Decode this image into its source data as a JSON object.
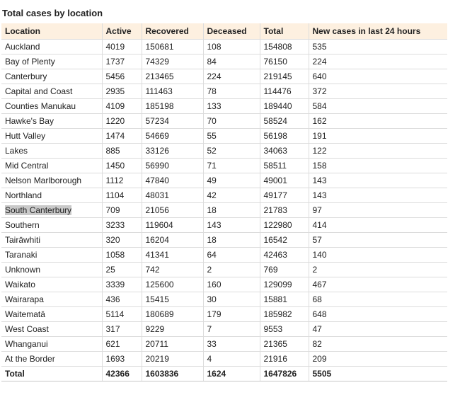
{
  "title": "Total cases by location",
  "columns": [
    "Location",
    "Active",
    "Recovered",
    "Deceased",
    "Total",
    "New cases in last 24 hours"
  ],
  "rows": [
    [
      "Auckland",
      "4019",
      "150681",
      "108",
      "154808",
      "535"
    ],
    [
      "Bay of Plenty",
      "1737",
      "74329",
      "84",
      "76150",
      "224"
    ],
    [
      "Canterbury",
      "5456",
      "213465",
      "224",
      "219145",
      "640"
    ],
    [
      "Capital and Coast",
      "2935",
      "111463",
      "78",
      "114476",
      "372"
    ],
    [
      "Counties Manukau",
      "4109",
      "185198",
      "133",
      "189440",
      "584"
    ],
    [
      "Hawke's Bay",
      "1220",
      "57234",
      "70",
      "58524",
      "162"
    ],
    [
      "Hutt Valley",
      "1474",
      "54669",
      "55",
      "56198",
      "191"
    ],
    [
      "Lakes",
      "885",
      "33126",
      "52",
      "34063",
      "122"
    ],
    [
      "Mid Central",
      "1450",
      "56990",
      "71",
      "58511",
      "158"
    ],
    [
      "Nelson Marlborough",
      "1112",
      "47840",
      "49",
      "49001",
      "143"
    ],
    [
      "Northland",
      "1104",
      "48031",
      "42",
      "49177",
      "143"
    ],
    [
      "South Canterbury",
      "709",
      "21056",
      "18",
      "21783",
      "97"
    ],
    [
      "Southern",
      "3233",
      "119604",
      "143",
      "122980",
      "414"
    ],
    [
      "Tairāwhiti",
      "320",
      "16204",
      "18",
      "16542",
      "57"
    ],
    [
      "Taranaki",
      "1058",
      "41341",
      "64",
      "42463",
      "140"
    ],
    [
      "Unknown",
      "25",
      "742",
      "2",
      "769",
      "2"
    ],
    [
      "Waikato",
      "3339",
      "125600",
      "160",
      "129099",
      "467"
    ],
    [
      "Wairarapa",
      "436",
      "15415",
      "30",
      "15881",
      "68"
    ],
    [
      "Waitematā",
      "5114",
      "180689",
      "179",
      "185982",
      "648"
    ],
    [
      "West Coast",
      "317",
      "9229",
      "7",
      "9553",
      "47"
    ],
    [
      "Whanganui",
      "621",
      "20711",
      "33",
      "21365",
      "82"
    ],
    [
      "At the Border",
      "1693",
      "20219",
      "4",
      "21916",
      "209"
    ]
  ],
  "total_row": [
    "Total",
    "42366",
    "1603836",
    "1624",
    "1647826",
    "5505"
  ],
  "highlighted_cell": "South Canterbury",
  "colors": {
    "header_background": "#fdf0e0",
    "highlight_background": "#c9c9c9",
    "grid_line": "#dcdcdc"
  }
}
